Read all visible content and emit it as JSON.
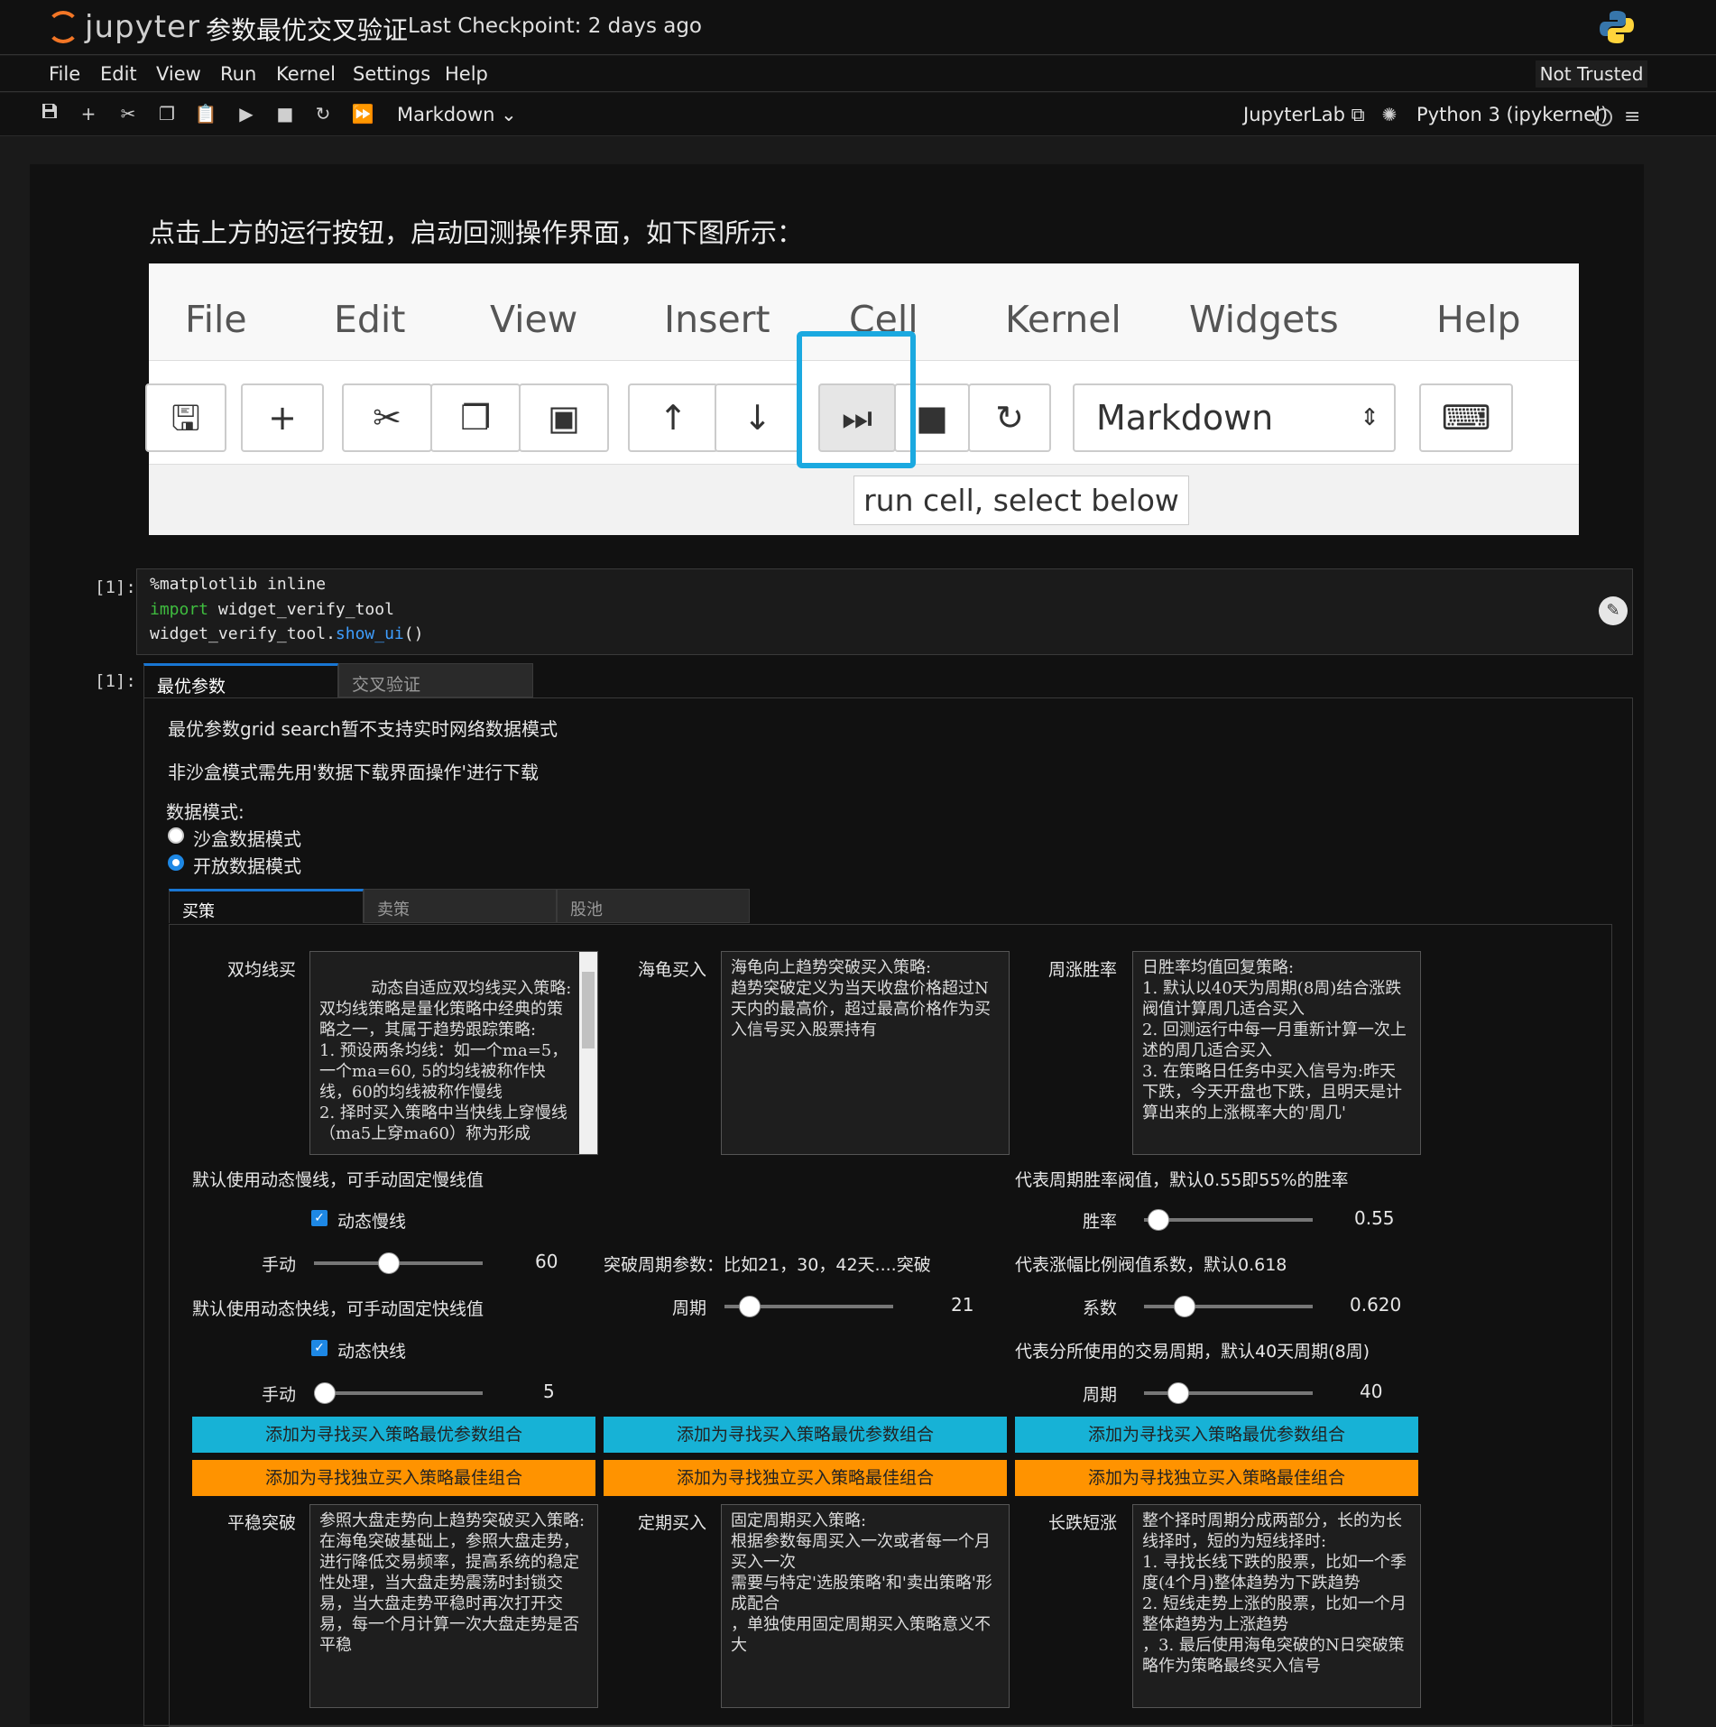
{
  "header": {
    "logo_text": "jupyter",
    "notebook_title": "参数最优交叉验证",
    "checkpoint": "Last Checkpoint: 2 days ago"
  },
  "menu": [
    "File",
    "Edit",
    "View",
    "Run",
    "Kernel",
    "Settings",
    "Help"
  ],
  "trust_label": "Not Trusted",
  "toolbar": {
    "cell_type": "Markdown",
    "jupyterlab": "JupyterLab",
    "kernel": "Python 3 (ipykernel)"
  },
  "markdown": {
    "text": "点击上方的运行按钮，启动回测操作界面，如下图所示：",
    "demo": {
      "menu": [
        "File",
        "Edit",
        "View",
        "Insert",
        "Cell",
        "Kernel",
        "Widgets",
        "Help"
      ],
      "cell_type": "Markdown",
      "tooltip": "run cell, select below"
    }
  },
  "code_cell": {
    "prompt": "[1]:",
    "lines": [
      "%matplotlib inline",
      "import widget_verify_tool",
      "widget_verify_tool.show_ui()"
    ]
  },
  "output": {
    "prompt": "[1]:",
    "tabs": [
      "最优参数",
      "交叉验证"
    ],
    "notice1": "最优参数grid search暂不支持实时网络数据模式",
    "notice2": "非沙盒模式需先用'数据下载界面操作'进行下载",
    "mode_label": "数据模式:",
    "modes": [
      "沙盒数据模式",
      "开放数据模式"
    ],
    "inner_tabs": [
      "买策",
      "卖策",
      "股池"
    ],
    "col1": {
      "label": "双均线买",
      "desc": "动态自适应双均线买入策略:\n双均线策略是量化策略中经典的策略之一，其属于趋势跟踪策略:\n1. 预设两条均线：如一个ma=5，一个ma=60, 5的均线被称作快线，60的均线被称作慢线\n2. 择时买入策略中当快线上穿慢线（ma5上穿ma60）称为形成",
      "slow_note": "默认使用动态慢线，可手动固定慢线值",
      "slow_chk": "动态慢线",
      "manual1": "手动",
      "manual1_val": "60",
      "fast_note": "默认使用动态快线，可手动固定快线值",
      "fast_chk": "动态快线",
      "manual2": "手动",
      "manual2_val": "5"
    },
    "col2": {
      "label": "海龟买入",
      "desc": "海龟向上趋势突破买入策略:\n趋势突破定义为当天收盘价格超过N天内的最高价，超过最高价格作为买入信号买入股票持有",
      "period_note": "突破周期参数：比如21，30，42天....突破",
      "period": "周期",
      "period_val": "21"
    },
    "col3": {
      "label": "周涨胜率",
      "desc": "日胜率均值回复策略:\n1. 默认以40天为周期(8周)结合涨跌阀值计算周几适合买入\n2. 回测运行中每一月重新计算一次上述的周几适合买入\n3. 在策略日任务中买入信号为:昨天下跌，今天开盘也下跌，且明天是计算出来的上涨概率大的'周几'",
      "win_note": "代表周期胜率阀值，默认0.55即55%的胜率",
      "win": "胜率",
      "win_val": "0.55",
      "coef_note": "代表涨幅比例阀值系数，默认0.618",
      "coef": "系数",
      "coef_val": "0.620",
      "per_note": "代表分所使用的交易周期，默认40天周期(8周)",
      "per": "周期",
      "per_val": "40"
    },
    "btn_blue": "添加为寻找买入策略最优参数组合",
    "btn_orange": "添加为寻找独立买入策略最佳组合",
    "row2": [
      {
        "label": "平稳突破",
        "desc": "参照大盘走势向上趋势突破买入策略:\n在海龟突破基础上，参照大盘走势，进行降低交易频率，提高系统的稳定性处理，当大盘走势震荡时封锁交易，当大盘走势平稳时再次打开交易，每一个月计算一次大盘走势是否平稳"
      },
      {
        "label": "定期买入",
        "desc": "固定周期买入策略:\n根据参数每周买入一次或者每一个月买入一次\n需要与特定'选股策略'和'卖出策略'形成配合\n，单独使用固定周期买入策略意义不大"
      },
      {
        "label": "长跌短涨",
        "desc": "整个择时周期分成两部分，长的为长线择时，短的为短线择时:\n1. 寻找长线下跌的股票，比如一个季度(4个月)整体趋势为下跌趋势\n2. 短线走势上涨的股票，比如一个月整体趋势为上涨趋势\n，3. 最后使用海龟突破的N日突破策略作为策略最终买入信号"
      }
    ]
  }
}
